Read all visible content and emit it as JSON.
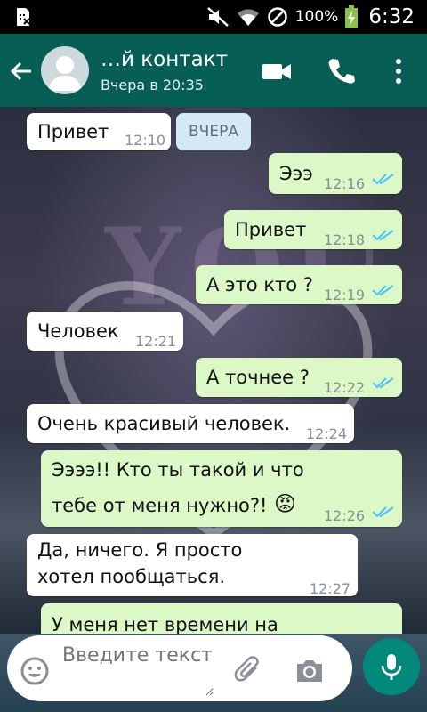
{
  "status_bar": {
    "battery": "100%",
    "time": "6:32"
  },
  "header": {
    "contact_name": "…й контакт",
    "last_seen": "Вчера в 20:35"
  },
  "chat": {
    "date_chip": "ВЧЕРА",
    "messages": [
      {
        "direction": "in",
        "text": "Привет",
        "time": "12:10"
      },
      {
        "direction": "out",
        "text": "Эээ",
        "time": "12:16",
        "read": true
      },
      {
        "direction": "out",
        "text": "Привет",
        "time": "12:18",
        "read": true
      },
      {
        "direction": "out",
        "text": "А это кто ?",
        "time": "12:19",
        "read": true
      },
      {
        "direction": "in",
        "text": "Человек",
        "time": "12:21"
      },
      {
        "direction": "out",
        "text": "А точнее ?",
        "time": "12:22",
        "read": true
      },
      {
        "direction": "in",
        "text": "Очень красивый человек.",
        "time": "12:24"
      },
      {
        "direction": "out",
        "text_line1": "Ээээ!! Кто ты такой и что",
        "text_line2": "тебе от меня нужно?!",
        "emoji": "😡",
        "time": "12:26",
        "read": true
      },
      {
        "direction": "in",
        "text_line1": "Да, ничего. Я просто",
        "text_line2": "хотел пообщаться.",
        "time": "12:27"
      },
      {
        "direction": "out",
        "text": "У меня нет времени на"
      }
    ]
  },
  "input": {
    "placeholder": "Введите текст"
  },
  "colors": {
    "header": "#075e54",
    "outgoing": "#dcf8c6",
    "incoming": "#ffffff",
    "ticks": "#4fc3f7",
    "mic": "#00897b"
  }
}
